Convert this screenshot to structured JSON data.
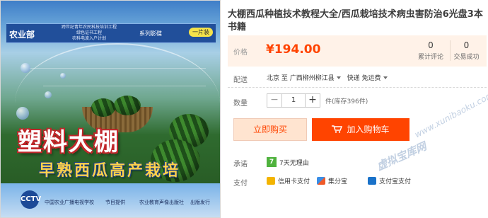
{
  "product_image": {
    "series_label": "农业部",
    "program_lines": [
      "跨世纪青年农民科技培训工程",
      "绿色证书工程",
      "农科电波入户计划"
    ],
    "series_tag": "系列影碟",
    "disc_count": "一片装",
    "title_main": "塑料大棚",
    "title_sub": "早熟西瓜高产栽培",
    "logo_text": "CCTV",
    "credit_1": "中国农业广播电视学校",
    "credit_2": "节目提供",
    "credit_3": "农业教育声像出版社",
    "credit_4": "出版发行"
  },
  "product": {
    "title": "大棚西瓜种植技术教程大全/西瓜栽培技术病虫害防治6光盘3本书籍"
  },
  "price": {
    "label": "价格",
    "value": "¥194.00",
    "color": "#ff4400"
  },
  "stats": {
    "reviews_count": "0",
    "reviews_label": "累计评论",
    "deals_count": "0",
    "deals_label": "交易成功"
  },
  "shipping": {
    "label": "配送",
    "from": "北京 至",
    "to": "广西柳州柳江县",
    "method": "快递 免运费"
  },
  "quantity": {
    "label": "数量",
    "minus": "−",
    "value": "1",
    "plus": "+",
    "stock": "件(库存396件)"
  },
  "actions": {
    "buy_now": "立即购买",
    "add_to_cart": "加入购物车"
  },
  "promise": {
    "label": "承诺",
    "badge": "7",
    "text": "7天无理由"
  },
  "payment": {
    "label": "支付",
    "methods": [
      "信用卡支付",
      "集分宝",
      "支付宝支付"
    ]
  },
  "watermarks": [
    "www.xunibaoku.com",
    "虚拟宝库网"
  ]
}
